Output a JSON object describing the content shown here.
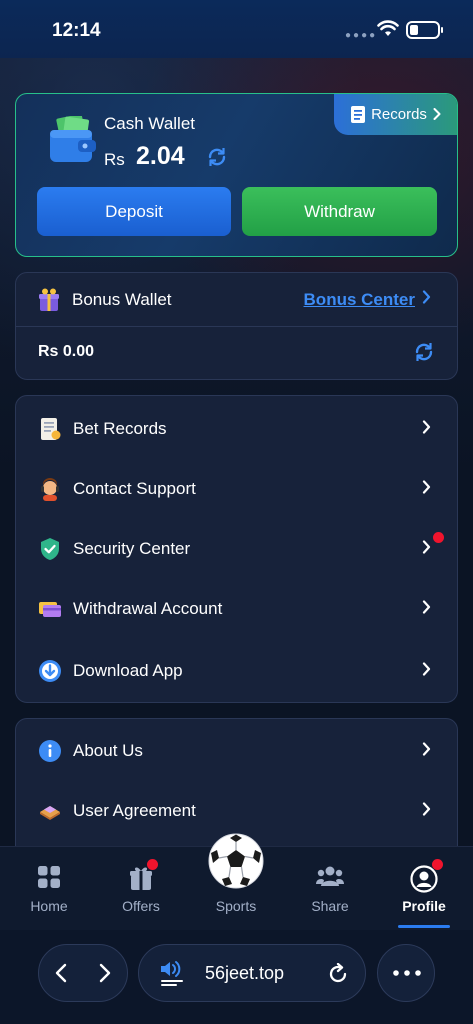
{
  "status_bar": {
    "time": "12:14"
  },
  "cash_wallet": {
    "title": "Cash Wallet",
    "currency": "Rs",
    "amount": "2.04",
    "records_label": "Records",
    "deposit_label": "Deposit",
    "withdraw_label": "Withdraw"
  },
  "bonus_wallet": {
    "title": "Bonus Wallet",
    "center_link": "Bonus Center",
    "amount": "Rs 0.00"
  },
  "menu_primary": [
    {
      "label": "Bet Records",
      "icon": "receipt-icon"
    },
    {
      "label": "Contact Support",
      "icon": "support-agent-icon"
    },
    {
      "label": "Security Center",
      "icon": "shield-icon"
    },
    {
      "label": "Withdrawal Account",
      "icon": "cards-icon"
    },
    {
      "label": "Download App",
      "icon": "download-icon"
    }
  ],
  "menu_secondary": [
    {
      "label": "About Us",
      "icon": "info-icon"
    },
    {
      "label": "User Agreement",
      "icon": "book-icon"
    }
  ],
  "bottom_nav": [
    {
      "label": "Home",
      "icon": "grid-icon"
    },
    {
      "label": "Offers",
      "icon": "gift-icon"
    },
    {
      "label": "Sports",
      "icon": "soccer-ball-icon"
    },
    {
      "label": "Share",
      "icon": "users-icon"
    },
    {
      "label": "Profile",
      "icon": "profile-icon",
      "active": true
    }
  ],
  "browser": {
    "url": "56jeet.top"
  },
  "colors": {
    "accent_blue": "#2b7cf0",
    "accent_green": "#22a046",
    "link_blue": "#3d8cf5",
    "notification_red": "#f0142d"
  }
}
